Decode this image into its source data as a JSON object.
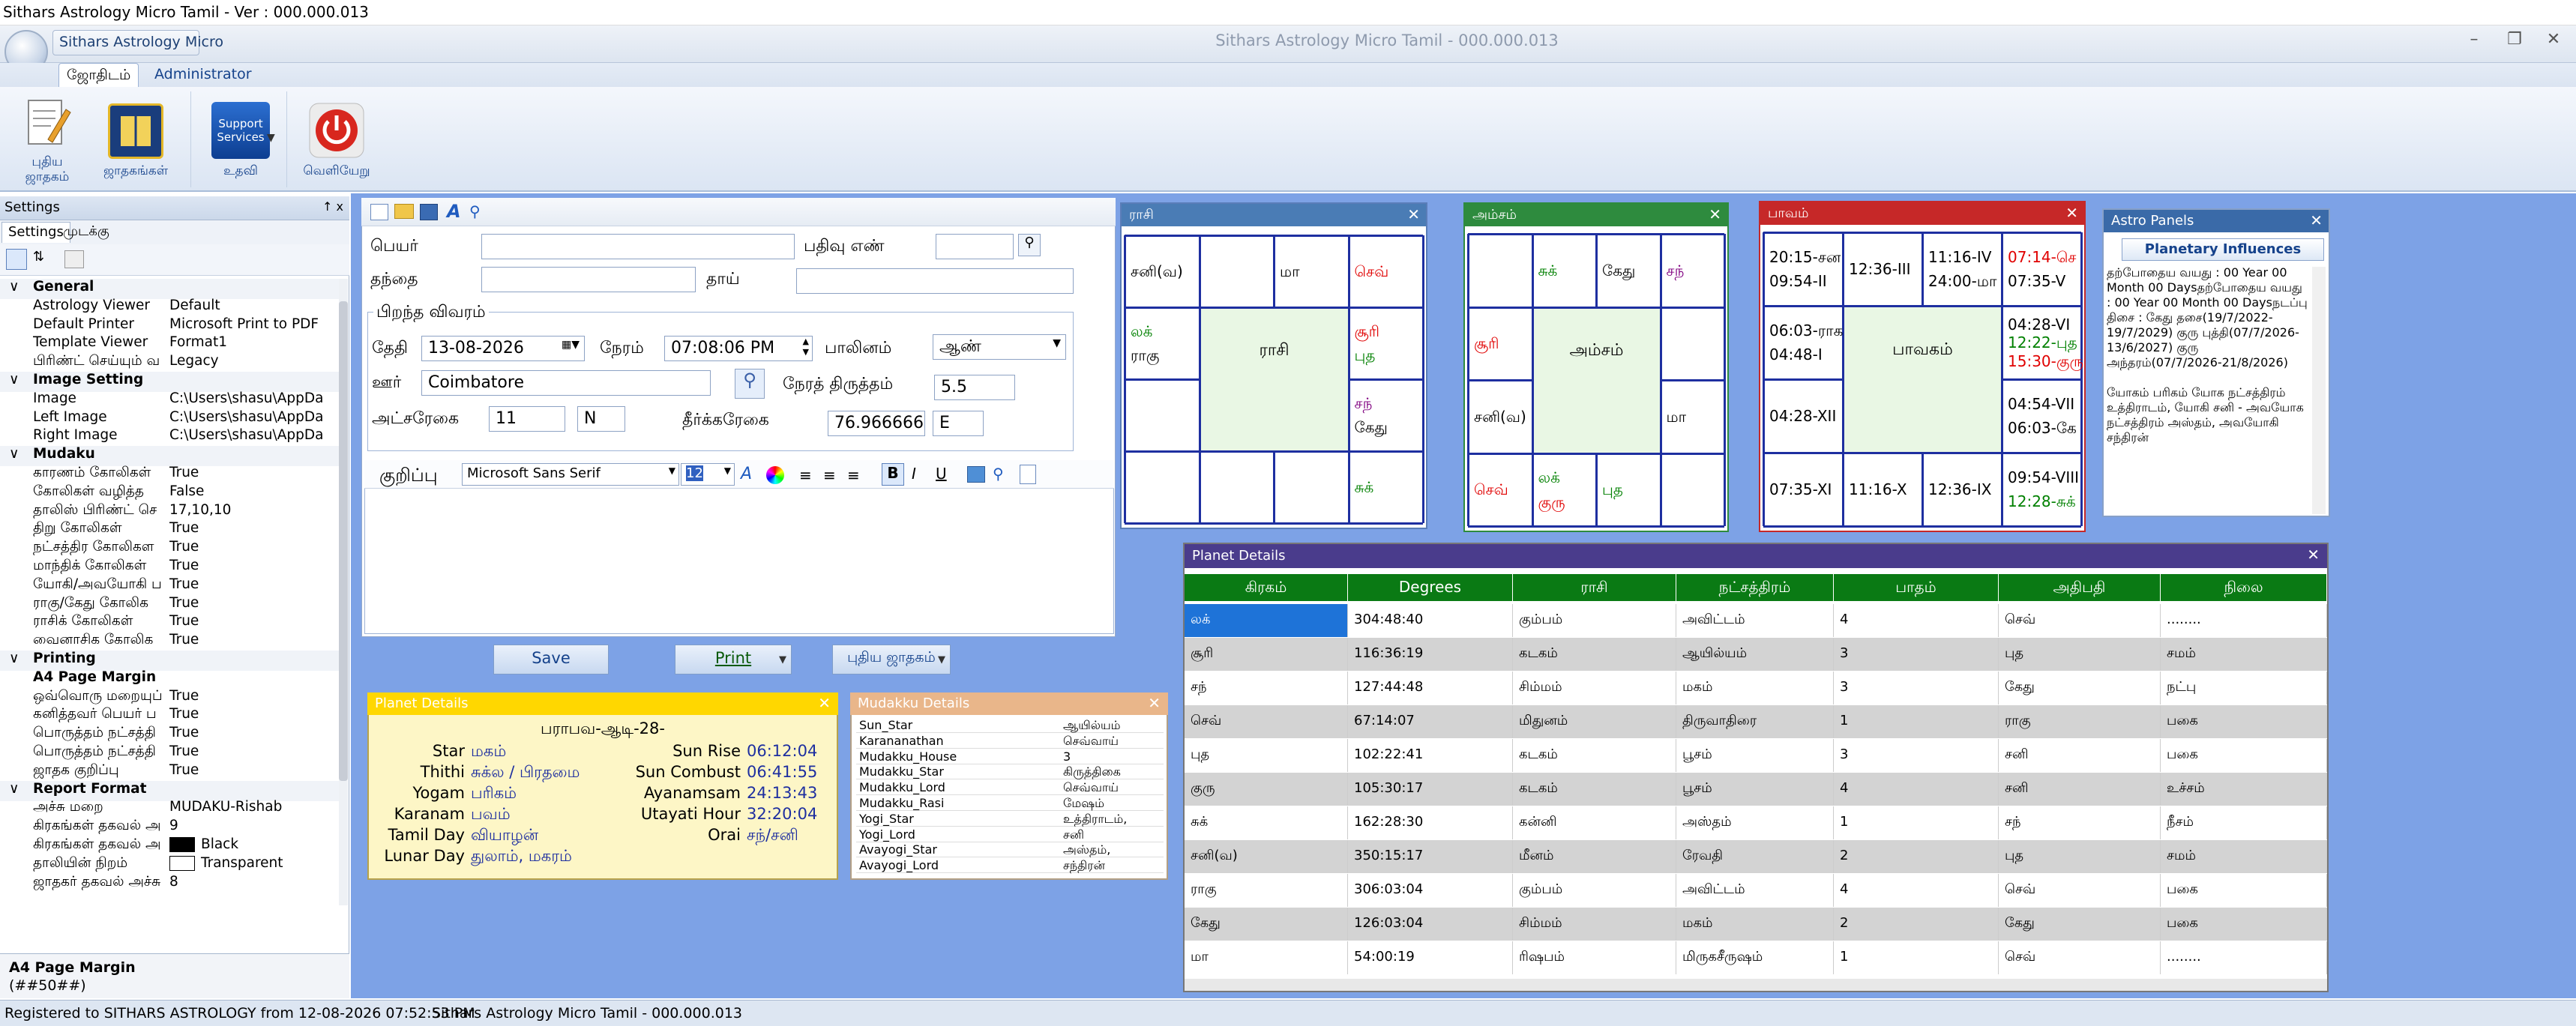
{
  "app": {
    "outer_title": "Sithars Astrology Micro Tamil  - Ver : 000.000.013",
    "qat_label": "Sithars Astrology Micro",
    "center_title": "Sithars Astrology Micro Tamil - 000.000.013",
    "tabs": [
      "ஜோதிடம்",
      "Administrator"
    ]
  },
  "ribbon": {
    "buttons": [
      {
        "label1": "புதிய",
        "label2": "ஜாதகம்"
      },
      {
        "label1": "ஜாதகங்கள்",
        "label2": ""
      },
      {
        "label1": "உதவி",
        "label2": "",
        "icon_text1": "Support",
        "icon_text2": "Services"
      },
      {
        "label1": "வெளியேறு",
        "label2": ""
      }
    ]
  },
  "settings": {
    "header": "Settings",
    "pin": "↑ x",
    "tabs": [
      "Settings",
      "முடக்கு"
    ],
    "categories": [
      {
        "name": "General",
        "rows": [
          {
            "k": "Astrology Viewer",
            "v": "Default"
          },
          {
            "k": "Default Printer",
            "v": "Microsoft Print to PDF"
          },
          {
            "k": "Template Viewer",
            "v": "Format1"
          },
          {
            "k": "பிரிண்ட் செய்யும் வ",
            "v": "Legacy"
          }
        ]
      },
      {
        "name": "Image Setting",
        "rows": [
          {
            "k": "Image",
            "v": "C:\\Users\\shasu\\AppDa"
          },
          {
            "k": "Left Image",
            "v": "C:\\Users\\shasu\\AppDa"
          },
          {
            "k": "Right Image",
            "v": "C:\\Users\\shasu\\AppDa"
          }
        ]
      },
      {
        "name": "Mudaku",
        "rows": [
          {
            "k": "காரணம் கோலிகள்",
            "v": "True"
          },
          {
            "k": "கோலிகள் வழித்த",
            "v": "False"
          },
          {
            "k": "தாலிஸ் பிரிண்ட் செ",
            "v": "17,10,10"
          },
          {
            "k": "திறு கோலிகள்",
            "v": "True"
          },
          {
            "k": "நட்சத்திர கோலிகள",
            "v": "True"
          },
          {
            "k": "மாந்திக் கோலிகள்",
            "v": "True"
          },
          {
            "k": "யோகி/அவயோகி ப",
            "v": "True"
          },
          {
            "k": "ராகு/கேது கோலிக",
            "v": "True"
          },
          {
            "k": "ராசிக் கோலிகள்",
            "v": "True"
          },
          {
            "k": "வைனாசிக கோலிக",
            "v": "True"
          }
        ]
      },
      {
        "name": "Printing",
        "rows": [
          {
            "k": "A4 Page Margin",
            "v": "",
            "bold": true
          },
          {
            "k": "ஒவ்வொரு மறையுப்",
            "v": "True"
          },
          {
            "k": "கனித்தவர் பெயர் ப",
            "v": "True"
          },
          {
            "k": "பொருத்தம் நட்சத்தி",
            "v": "True"
          },
          {
            "k": "பொருத்தம் நட்சத்தி",
            "v": "True"
          },
          {
            "k": "ஜாதக குறிப்பு",
            "v": "True"
          }
        ]
      },
      {
        "name": "Report Format",
        "rows": [
          {
            "k": "அச்சு மறை",
            "v": "MUDAKU-Rishab"
          },
          {
            "k": "கிரகங்கள் தகவல் அ",
            "v": "9"
          },
          {
            "k": "கிரகங்கள் தகவல் அ",
            "v": "Black",
            "swatch": "#000000"
          },
          {
            "k": "தாலியின் நிறம்",
            "v": "Transparent",
            "swatch": "#ffffff"
          },
          {
            "k": "ஜாதகர் தகவல் அச்சு",
            "v": "8"
          }
        ]
      }
    ],
    "desc_title": "A4 Page Margin",
    "desc_text": "(##50##)"
  },
  "status": {
    "left": "Registered to SITHARS ASTROLOGY from 12-08-2026 07:52:53 PM",
    "right": "Sithars Astrology Micro Tamil  -  000.000.013"
  },
  "form": {
    "name_label": "பெயர்",
    "reg_label": "பதிவு எண்",
    "father_label": "தந்தை",
    "mother_label": "தாய்",
    "birth_group": "பிறந்த விவரம்",
    "date_label": "தேதி",
    "date_value": "13-08-2026",
    "time_label": "நேரம்",
    "time_value": "07:08:06 PM",
    "gender_label": "பாலினம்",
    "gender_value": "ஆண்",
    "place_label": "ஊர்",
    "place_value": "Coimbatore",
    "tz_label": "நேரத் திருத்தம்",
    "tz_value": "5.5",
    "lat_label": "அட்சரேகை",
    "lat_value": "11",
    "lat_dir": "N",
    "lon_label": "தீர்க்கரேகை",
    "lon_value": "76.9666667",
    "lon_dir": "E",
    "note_label": "குறிப்பு",
    "font_name": "Microsoft Sans Serif",
    "font_size": "12",
    "save_label": "Save",
    "print_label": "Print",
    "new_label": "புதிய ஜாதகம்"
  },
  "rasi": {
    "title": "ராசி",
    "center": "ராசி",
    "header_color": "#4a7cb5",
    "cells": [
      {
        "c": 0,
        "r": 0,
        "lines": [
          [
            "சனி(வ)",
            "#000"
          ]
        ]
      },
      {
        "c": 2,
        "r": 0,
        "lines": [
          [
            "மா",
            "#000"
          ]
        ]
      },
      {
        "c": 3,
        "r": 0,
        "lines": [
          [
            "செவ்",
            "#e00000"
          ]
        ]
      },
      {
        "c": 0,
        "r": 1,
        "lines": [
          [
            "லக்",
            "#008000"
          ],
          [
            "ராகு",
            "#000"
          ]
        ]
      },
      {
        "c": 3,
        "r": 1,
        "lines": [
          [
            "சூரி",
            "#e00000"
          ],
          [
            "புத",
            "#008000"
          ]
        ]
      },
      {
        "c": 3,
        "r": 2,
        "lines": [
          [
            "சந்",
            "#800080"
          ],
          [
            "கேது",
            "#000"
          ]
        ]
      },
      {
        "c": 3,
        "r": 3,
        "lines": [
          [
            "சுக்",
            "#008000"
          ]
        ]
      }
    ]
  },
  "amsam": {
    "title": "அம்சம்",
    "center": "அம்சம்",
    "header_color": "#2e8b3e",
    "cells": [
      {
        "c": 1,
        "r": 0,
        "lines": [
          [
            "சுக்",
            "#008000"
          ]
        ]
      },
      {
        "c": 2,
        "r": 0,
        "lines": [
          [
            "கேது",
            "#000"
          ]
        ]
      },
      {
        "c": 3,
        "r": 0,
        "lines": [
          [
            "சந்",
            "#800080"
          ]
        ]
      },
      {
        "c": 0,
        "r": 1,
        "lines": [
          [
            "சூரி",
            "#e00000"
          ]
        ]
      },
      {
        "c": 0,
        "r": 2,
        "lines": [
          [
            "சனி(வ)",
            "#000"
          ]
        ]
      },
      {
        "c": 3,
        "r": 2,
        "lines": [
          [
            "மா",
            "#000"
          ]
        ]
      },
      {
        "c": 0,
        "r": 3,
        "lines": [
          [
            "செவ்",
            "#e00000"
          ]
        ]
      },
      {
        "c": 1,
        "r": 3,
        "lines": [
          [
            "லக்",
            "#008000"
          ],
          [
            "குரு",
            "#e00000"
          ]
        ]
      },
      {
        "c": 2,
        "r": 3,
        "lines": [
          [
            "புத",
            "#008000"
          ]
        ]
      }
    ]
  },
  "bhavam": {
    "title": "பாவம்",
    "center": "பாவகம்",
    "header_color": "#c62828",
    "cells": [
      {
        "c": 0,
        "r": 0,
        "lines": [
          [
            "20:15-சன",
            "#000"
          ],
          [
            "09:54-II",
            "#000"
          ]
        ]
      },
      {
        "c": 1,
        "r": 0,
        "lines": [
          [
            "12:36-III",
            "#000"
          ]
        ]
      },
      {
        "c": 2,
        "r": 0,
        "lines": [
          [
            "11:16-IV",
            "#000"
          ],
          [
            "24:00-மா",
            "#000"
          ]
        ]
      },
      {
        "c": 3,
        "r": 0,
        "lines": [
          [
            "07:14-செ",
            "#e00000"
          ],
          [
            "07:35-V",
            "#000"
          ]
        ]
      },
      {
        "c": 0,
        "r": 1,
        "lines": [
          [
            "06:03-ராக",
            "#000"
          ],
          [
            "04:48-I",
            "#000"
          ]
        ]
      },
      {
        "c": 3,
        "r": 1,
        "lines": [
          [
            "04:28-VI",
            "#000"
          ],
          [
            "12:22-புத",
            "#008000"
          ],
          [
            "15:30-குரு",
            "#e00000"
          ]
        ]
      },
      {
        "c": 0,
        "r": 2,
        "lines": [
          [
            "04:28-XII",
            "#000"
          ]
        ]
      },
      {
        "c": 3,
        "r": 2,
        "lines": [
          [
            "04:54-VII",
            "#000"
          ],
          [
            "06:03-கே",
            "#000"
          ]
        ]
      },
      {
        "c": 0,
        "r": 3,
        "lines": [
          [
            "07:35-XI",
            "#000"
          ]
        ]
      },
      {
        "c": 1,
        "r": 3,
        "lines": [
          [
            "11:16-X",
            "#000"
          ]
        ]
      },
      {
        "c": 2,
        "r": 3,
        "lines": [
          [
            "12:36-IX",
            "#000"
          ]
        ]
      },
      {
        "c": 3,
        "r": 3,
        "lines": [
          [
            "09:54-VIII",
            "#000"
          ],
          [
            "12:28-சுக்",
            "#008000"
          ]
        ]
      }
    ]
  },
  "astro_panels": {
    "title": "Astro Panels",
    "tab": "Planetary Influences",
    "text": "தற்போதைய வயது : 00 Year 00 Month 00 Daysதற்போதைய வயது : 00 Year 00 Month 00 Daysநடப்பு திசை : கேது தசை(19/7/2022-19/7/2029) குரு புத்தி(07/7/2026-13/6/2027) குரு அந்தரம்(07/7/2026-21/8/2026)",
    "text2": "யோகம் பரிகம் யோக நட்சத்திரம் உத்திராடம், யோகி சனி - அவயோக நட்சத்திரம் அஸ்தம், அவயோகி சந்திரன்"
  },
  "planet_details": {
    "title": "Planet Details",
    "header": "பராபவ-ஆடி-28-",
    "rows": [
      {
        "l": "Star",
        "lv": "மகம்",
        "r": "Sun Rise",
        "rv": "06:12:04"
      },
      {
        "l": "Thithi",
        "lv": "சுக்ல / பிரதமை",
        "r": "Sun Combust",
        "rv": "06:41:55"
      },
      {
        "l": "Yogam",
        "lv": "பரிகம்",
        "r": "Ayanamsam",
        "rv": "24:13:43"
      },
      {
        "l": "Karanam",
        "lv": "பவம்",
        "r": "Utayati Hour",
        "rv": "32:20:04"
      },
      {
        "l": "Tamil Day",
        "lv": "வியாழன்",
        "r": "Orai",
        "rv": "சந்/சனி"
      },
      {
        "l": "Lunar Day",
        "lv": "துலாம், மகரம்",
        "r": "",
        "rv": ""
      }
    ]
  },
  "mudakku": {
    "title": "Mudakku Details",
    "rows": [
      {
        "a": "Sun_Star",
        "b": "ஆயில்யம்"
      },
      {
        "a": "Karananathan",
        "b": "செவ்வாய்"
      },
      {
        "a": "Mudakku_House",
        "b": "3"
      },
      {
        "a": "Mudakku_Star",
        "b": "கிருத்திகை"
      },
      {
        "a": "Mudakku_Lord",
        "b": "செவ்வாய்"
      },
      {
        "a": "Mudakku_Rasi",
        "b": "மேஷம்"
      },
      {
        "a": "Yogi_Star",
        "b": "உத்திராடம்,"
      },
      {
        "a": "Yogi_Lord",
        "b": "சனி"
      },
      {
        "a": "Avayogi_Star",
        "b": "அஸ்தம்,"
      },
      {
        "a": "Avayogi_Lord",
        "b": "சந்திரன்"
      }
    ]
  },
  "planet_table": {
    "title": "Planet Details",
    "headers": [
      "கிரகம்",
      "Degrees",
      "ராசி",
      "நட்சத்திரம்",
      "பாதம்",
      "அதிபதி",
      "நிலை"
    ],
    "rows": [
      [
        "லக்",
        "304:48:40",
        "கும்பம்",
        "அவிட்டம்",
        "4",
        "செவ்",
        "........"
      ],
      [
        "சூரி",
        "116:36:19",
        "கடகம்",
        "ஆயில்யம்",
        "3",
        "புத",
        "சமம்"
      ],
      [
        "சந்",
        "127:44:48",
        "சிம்மம்",
        "மகம்",
        "3",
        "கேது",
        "நட்பு"
      ],
      [
        "செவ்",
        "67:14:07",
        "மிதுனம்",
        "திருவாதிரை",
        "1",
        "ராகு",
        "பகை"
      ],
      [
        "புத",
        "102:22:41",
        "கடகம்",
        "பூசம்",
        "3",
        "சனி",
        "பகை"
      ],
      [
        "குரு",
        "105:30:17",
        "கடகம்",
        "பூசம்",
        "4",
        "சனி",
        "உச்சம்"
      ],
      [
        "சுக்",
        "162:28:30",
        "கன்னி",
        "அஸ்தம்",
        "1",
        "சந்",
        "நீசம்"
      ],
      [
        "சனி(வ)",
        "350:15:17",
        "மீனம்",
        "ரேவதி",
        "2",
        "புத",
        "சமம்"
      ],
      [
        "ராகு",
        "306:03:04",
        "கும்பம்",
        "அவிட்டம்",
        "4",
        "செவ்",
        "பகை"
      ],
      [
        "கேது",
        "126:03:04",
        "சிம்மம்",
        "மகம்",
        "2",
        "கேது",
        "பகை"
      ],
      [
        "மா",
        "54:00:19",
        "ரிஷபம்",
        "மிருகசீருஷம்",
        "1",
        "செவ்",
        "........"
      ]
    ]
  }
}
